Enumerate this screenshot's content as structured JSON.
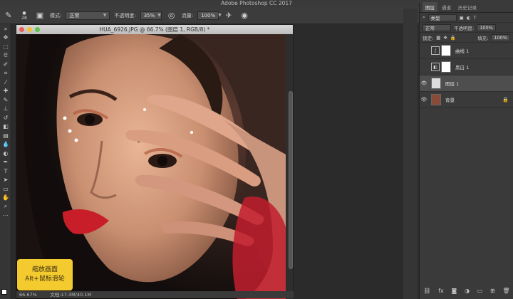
{
  "app": {
    "title": "Adobe Photoshop CC 2017"
  },
  "options": {
    "mode_label": "模式:",
    "mode_value": "正常",
    "opacity_label": "不透明度:",
    "opacity_value": "35%",
    "flow_label": "流量:",
    "flow_value": "100%",
    "brush_size": "28"
  },
  "document": {
    "title": "HUA_6926.JPG @ 66.7% (图层 1, RGB/8) *",
    "zoom": "66.67%",
    "status": "文档:17.3M/40.1M"
  },
  "hint": {
    "line1": "缩放画面",
    "line2": "Alt+鼠标滑轮"
  },
  "layers_panel": {
    "tabs": [
      "图层",
      "通道",
      "历史记录"
    ],
    "kind_label": "类型",
    "blend_value": "正常",
    "opacity_label": "不透明度:",
    "opacity_value": "100%",
    "lock_label": "锁定:",
    "fill_label": "填充:",
    "fill_value": "100%",
    "layers": [
      {
        "name": "曲线 1",
        "type": "curves"
      },
      {
        "name": "黑白 1",
        "type": "black-white"
      },
      {
        "name": "图层 1",
        "type": "pixel",
        "selected": true
      },
      {
        "name": "背景",
        "type": "background",
        "locked": true
      }
    ]
  },
  "colors": {
    "hint_bg": "#f3cb2f",
    "panel_bg": "#3a3a3a",
    "selected_layer": "#4e4e4e"
  }
}
